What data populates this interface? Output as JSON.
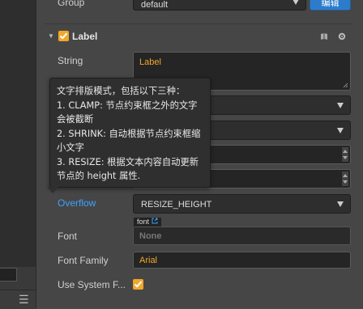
{
  "group": {
    "label": "Group",
    "value": "default",
    "edit_button": "编辑"
  },
  "component": {
    "title": "Label"
  },
  "properties": {
    "string_label": "String",
    "string_value": "Label",
    "overflow_label": "Overflow",
    "overflow_value": "RESIZE_HEIGHT",
    "font_label": "Font",
    "font_tag": "font",
    "font_placeholder": "None",
    "font_family_label": "Font Family",
    "font_family_value": "Arial",
    "use_system_font_label": "Use System F...",
    "use_system_font_checked": true
  },
  "tooltip": {
    "text": "文字排版模式，包括以下三种：\n1. CLAMP: 节点约束框之外的文字会被截断\n2. SHRINK: 自动根据节点约束框缩小文字\n3. RESIZE: 根据文本内容自动更新节点的 height 属性."
  },
  "colors": {
    "accent_orange": "#f0a82c",
    "link_blue": "#3ea2ff",
    "edit_button_blue": "#2d7ccc"
  },
  "icons": [
    "collapse-arrow-icon",
    "book-icon",
    "gear-icon",
    "chevron-down-icon",
    "link-icon",
    "menu-icon",
    "checkmark-icon"
  ]
}
